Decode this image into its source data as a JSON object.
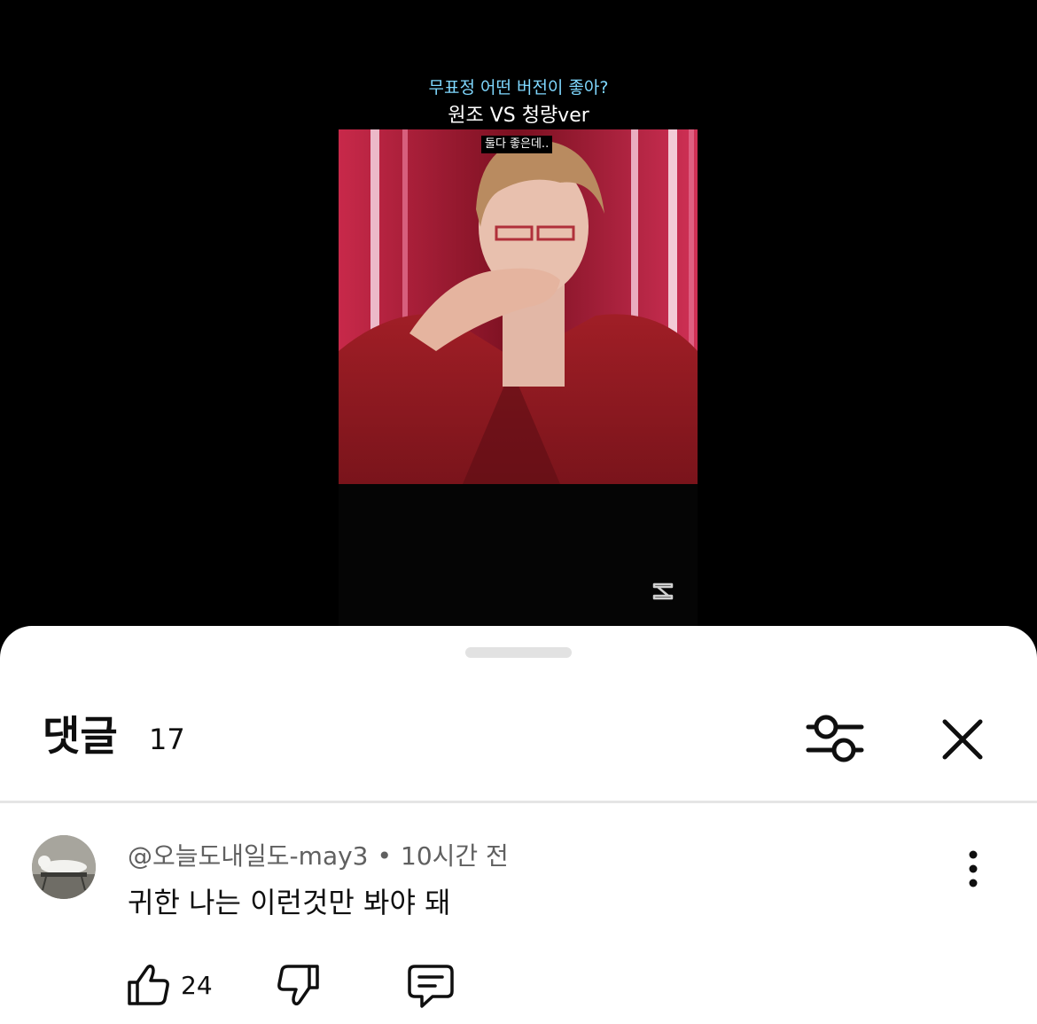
{
  "video": {
    "caption_question": "무표정 어떤 버전이 좋아?",
    "caption_title": "원조 VS 청량ver",
    "frame_subtitle": "둘다 좋은데.."
  },
  "comments_sheet": {
    "title": "댓글",
    "count": "17",
    "icons": {
      "filter": "sliders-icon",
      "close": "close-icon"
    }
  },
  "comments": [
    {
      "author": "@오늘도내일도-may3",
      "separator": "•",
      "time": "10시간 전",
      "text": "귀한 나는 이런것만 봐야 돼",
      "likes": "24",
      "icons": {
        "like": "thumbs-up-icon",
        "dislike": "thumbs-down-icon",
        "reply": "reply-icon",
        "more": "more-vertical-icon"
      }
    }
  ],
  "colors": {
    "caption_question": "#7fd8ff",
    "sheet_background": "#ffffff",
    "text_primary": "#0f0f0f",
    "text_secondary": "#606060"
  }
}
